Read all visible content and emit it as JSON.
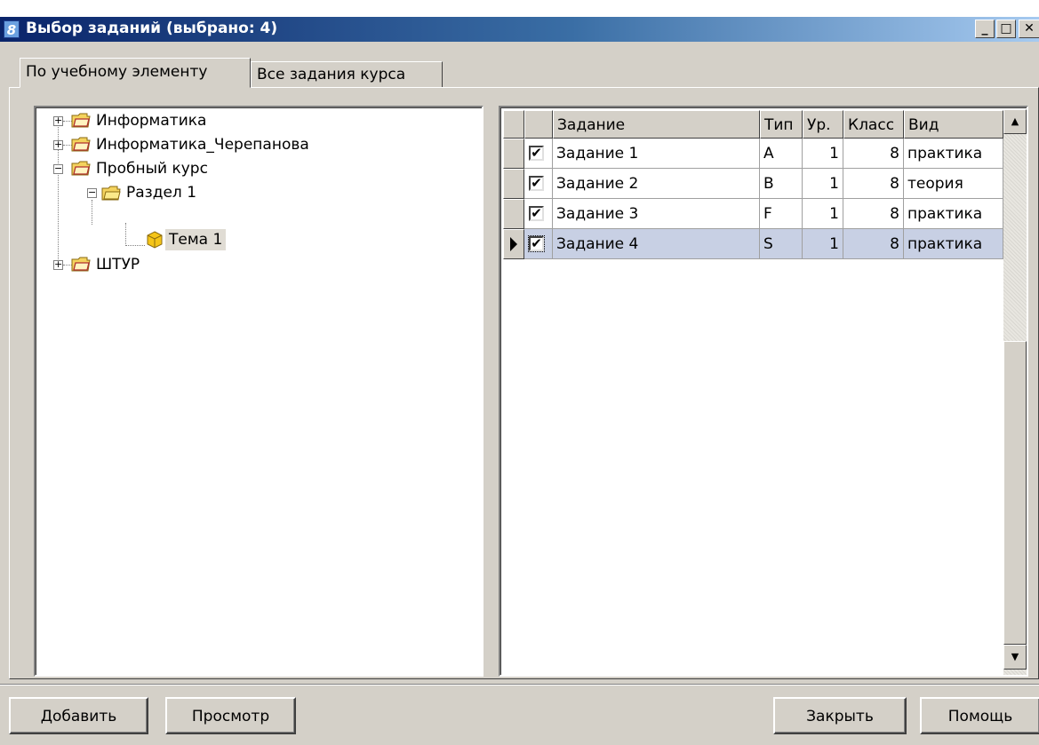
{
  "window": {
    "title": "Выбор заданий (выбрано: 4)",
    "app_icon": "8",
    "buttons": [
      "minimize-icon",
      "maximize-icon",
      "close-icon"
    ]
  },
  "tabs": [
    {
      "label": "По учебному элементу",
      "active": true
    },
    {
      "label": "Все задания курса",
      "active": false
    }
  ],
  "tree": {
    "items": [
      {
        "label": "Информатика",
        "expander": "+",
        "icon": "book-folder-icon"
      },
      {
        "label": "Информатика_Черепанова",
        "expander": "+",
        "icon": "book-folder-icon"
      },
      {
        "label": "Пробный курс",
        "expander": "-",
        "icon": "book-folder-icon"
      },
      {
        "label": "Раздел 1",
        "expander": "-",
        "icon": "folder-icon"
      },
      {
        "label": "Тема 1",
        "icon": "cube-icon",
        "selected": true
      },
      {
        "label": "ШТУР",
        "expander": "+",
        "icon": "book-folder-icon"
      }
    ]
  },
  "grid": {
    "columns": [
      "",
      "Задание",
      "Тип",
      "Ур.",
      "Класс",
      "Вид"
    ],
    "rows": [
      {
        "checked": true,
        "task": "Задание 1",
        "type": "A",
        "level": "1",
        "class": "8",
        "kind": "практика"
      },
      {
        "checked": true,
        "task": "Задание 2",
        "type": "B",
        "level": "1",
        "class": "8",
        "kind": "теория"
      },
      {
        "checked": true,
        "task": "Задание 3",
        "type": "F",
        "level": "1",
        "class": "8",
        "kind": "практика"
      },
      {
        "checked": true,
        "task": "Задание 4",
        "type": "S",
        "level": "1",
        "class": "8",
        "kind": "практика",
        "current": true
      }
    ],
    "check_glyph": "✔"
  },
  "footer": {
    "add": "Добавить",
    "view": "Просмотр",
    "close": "Закрыть",
    "help": "Помощь"
  },
  "colors": {
    "title_start": "#0a246a",
    "title_end": "#a6caf0",
    "face": "#d4d0c8",
    "current_row": "#c8d0e4"
  }
}
